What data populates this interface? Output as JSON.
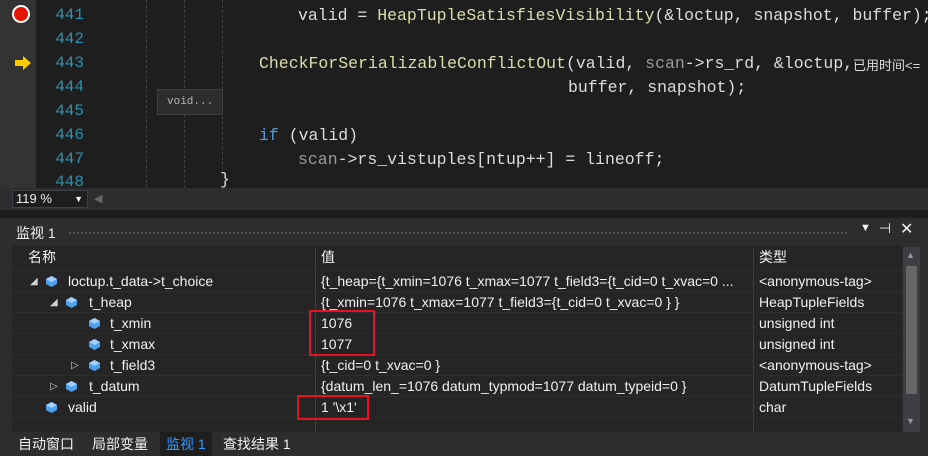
{
  "editor": {
    "lines": [
      {
        "no": "441"
      },
      {
        "no": "442"
      },
      {
        "no": "443"
      },
      {
        "no": "444"
      },
      {
        "no": "445"
      },
      {
        "no": "446"
      },
      {
        "no": "447"
      },
      {
        "no": "448"
      }
    ],
    "code": {
      "l441_a": "valid = ",
      "l441_fn": "HeapTupleSatisfiesVisibility",
      "l441_b": "(&loctup, snapshot, buffer);",
      "l443_fn": "CheckForSerializableConflictOut",
      "l443_a": "(valid, ",
      "l443_pm": "scan",
      "l443_b": "->",
      "l443_c": "rs_rd, &loctup,",
      "l444": "buffer, snapshot);",
      "l446_kw": "if",
      "l446_b": " (valid)",
      "l447_pm": "scan",
      "l447_a": "->",
      "l447_b": "rs_vistuples[ntup++] = lineoff;",
      "l448": "}"
    },
    "tooltip": "void...",
    "elapsed_label": "已用时间<="
  },
  "zoom": {
    "value": "119 %"
  },
  "watch": {
    "title": "监视 1",
    "columns": {
      "name": "名称",
      "value": "值",
      "type": "类型"
    },
    "rows": [
      {
        "name": "loctup.t_data->t_choice",
        "value": "{t_heap={t_xmin=1076 t_xmax=1077 t_field3={t_cid=0 t_xvac=0 ...",
        "type": "<anonymous-tag>"
      },
      {
        "name": "t_heap",
        "value": "{t_xmin=1076 t_xmax=1077 t_field3={t_cid=0 t_xvac=0 } }",
        "type": "HeapTupleFields"
      },
      {
        "name": "t_xmin",
        "value": "1076",
        "type": "unsigned int"
      },
      {
        "name": "t_xmax",
        "value": "1077",
        "type": "unsigned int"
      },
      {
        "name": "t_field3",
        "value": "{t_cid=0 t_xvac=0 }",
        "type": "<anonymous-tag>"
      },
      {
        "name": "t_datum",
        "value": "{datum_len_=1076 datum_typmod=1077 datum_typeid=0 }",
        "type": "DatumTupleFields"
      },
      {
        "name": "valid",
        "value": "1 '\\x1'",
        "type": "char"
      }
    ]
  },
  "tabs": [
    {
      "label": "自动窗口"
    },
    {
      "label": "局部变量"
    },
    {
      "label": "监视 1"
    },
    {
      "label": "查找结果 1"
    }
  ],
  "colors": {
    "accent": "#3399ff",
    "highlight": "#e81123",
    "breakpoint": "#e51400",
    "arrow": "#ffcc00"
  }
}
